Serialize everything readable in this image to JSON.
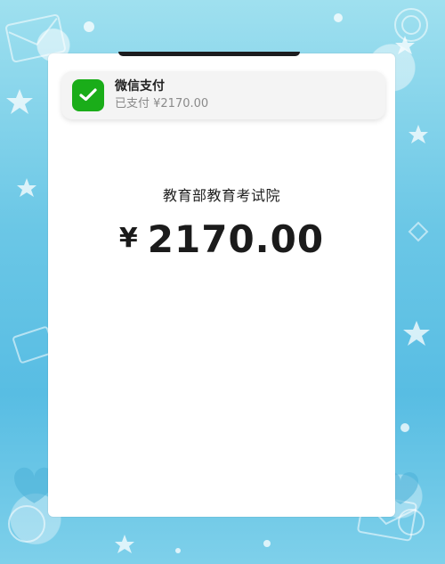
{
  "notification": {
    "app_name": "微信支付",
    "message": "已支付 ¥2170.00",
    "icon": "wechat-pay-icon",
    "icon_color": "#1aad19"
  },
  "payment": {
    "merchant": "教育部教育考试院",
    "currency_symbol": "¥",
    "amount": "2170.00"
  },
  "colors": {
    "background": "#6bc7e6"
  }
}
